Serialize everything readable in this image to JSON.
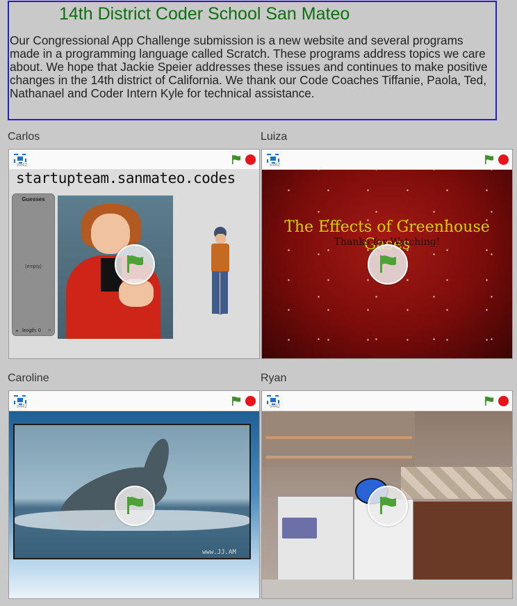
{
  "intro": {
    "title": "14th District Coder School San Mateo",
    "body": "Our Congressional App Challenge submission is a new website and several programs made in a programming language called Scratch. These programs address topics we care about. We hope that Jackie Speier addresses these issues and continues to make positive changes in the 14th district of California. We thank our Code Coaches Tiffanie, Paola, Ted, Nathanael and Coder Intern Kyle for technical assistance."
  },
  "player": {
    "version": "v442"
  },
  "projects": [
    {
      "name": "Carlos",
      "stage_text": "startupteam.sanmateo.codes",
      "list_title": "Guesses",
      "list_empty": "(empty)",
      "list_add": "+",
      "list_length": "length: 0",
      "list_resize": "="
    },
    {
      "name": "Luiza",
      "stage_title": "The Effects of Greenhouse Gases",
      "stage_subtitle": "Thanks for Watching!"
    },
    {
      "name": "Caroline",
      "stage_watermark": "www.JJ.AM"
    },
    {
      "name": "Ryan"
    }
  ],
  "colors": {
    "title_green": "#0e6f0e",
    "border_blue": "#1f1fd6",
    "flag_green": "#3e8f2a",
    "stop_red": "#e8141a"
  },
  "icons": [
    "fullscreen-icon",
    "green-flag-icon",
    "stop-icon",
    "play-flag-icon"
  ]
}
